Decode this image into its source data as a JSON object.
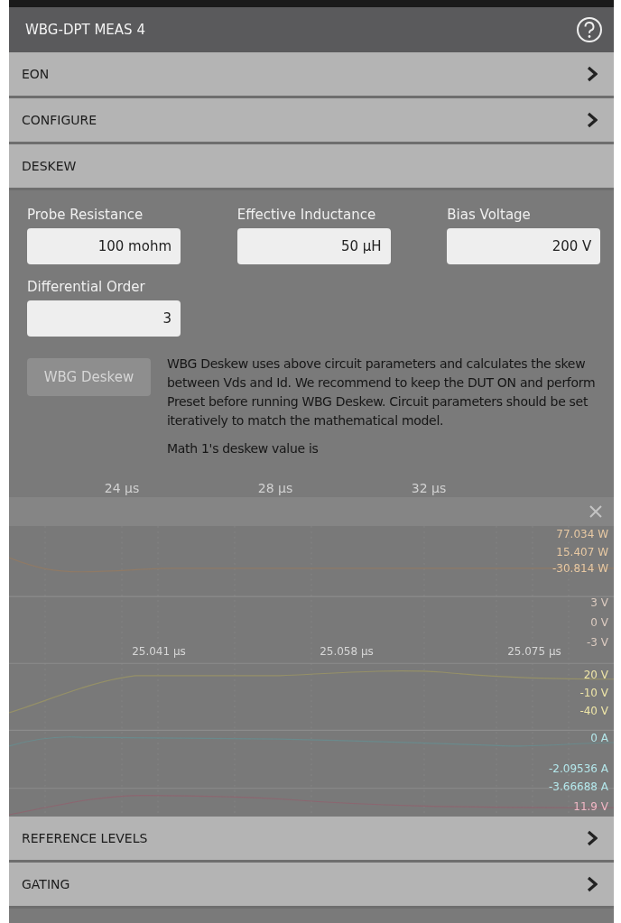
{
  "window": {
    "title": "WBG-DPT MEAS 4"
  },
  "sections_top": [
    {
      "label": "EON",
      "expanded": false
    },
    {
      "label": "CONFIGURE",
      "expanded": false
    },
    {
      "label": "DESKEW",
      "expanded": true
    }
  ],
  "deskew": {
    "fields": [
      {
        "label": "Probe Resistance",
        "value": "100 mohm"
      },
      {
        "label": "Effective Inductance",
        "value": "50 µH"
      },
      {
        "label": "Bias Voltage",
        "value": "200 V"
      },
      {
        "label": "Differential Order",
        "value": "3"
      }
    ],
    "button": {
      "label": "WBG Deskew",
      "disabled": true
    },
    "description": "WBG Deskew uses above circuit parameters and calculates the skew between Vds and Id. We recommend to keep the DUT ON and perform Preset before running WBG Deskew. Circuit parameters should be set iteratively to match the mathematical model.",
    "result": "Math 1's deskew value is"
  },
  "scope_background": {
    "upper_time_labels": [
      "24 µs",
      "28 µs",
      "32 µs"
    ],
    "time_labels": [
      "25.041 µs",
      "25.058 µs",
      "25.075 µs"
    ],
    "axis_labels": [
      {
        "text": "77.034 W",
        "color": "#e8c9a3"
      },
      {
        "text": "15.407 W",
        "color": "#e8c9a3"
      },
      {
        "text": "-30.814 W",
        "color": "#e8c9a3"
      },
      {
        "text": "3 V",
        "color": "#dccbc0"
      },
      {
        "text": "0 V",
        "color": "#dccbc0"
      },
      {
        "text": "-3 V",
        "color": "#dccbc0"
      },
      {
        "text": "20 V",
        "color": "#efe6a8"
      },
      {
        "text": "-10 V",
        "color": "#efe6a8"
      },
      {
        "text": "-40 V",
        "color": "#efe6a8"
      },
      {
        "text": "0 A",
        "color": "#b4e8ec"
      },
      {
        "text": "-2.09536 A",
        "color": "#b4e8ec"
      },
      {
        "text": "-3.66688 A",
        "color": "#b4e8ec"
      },
      {
        "text": "11.9 V",
        "color": "#f2b8c6"
      }
    ]
  },
  "sections_bottom": [
    {
      "label": "REFERENCE LEVELS",
      "expanded": false
    },
    {
      "label": "GATING",
      "expanded": false
    }
  ]
}
